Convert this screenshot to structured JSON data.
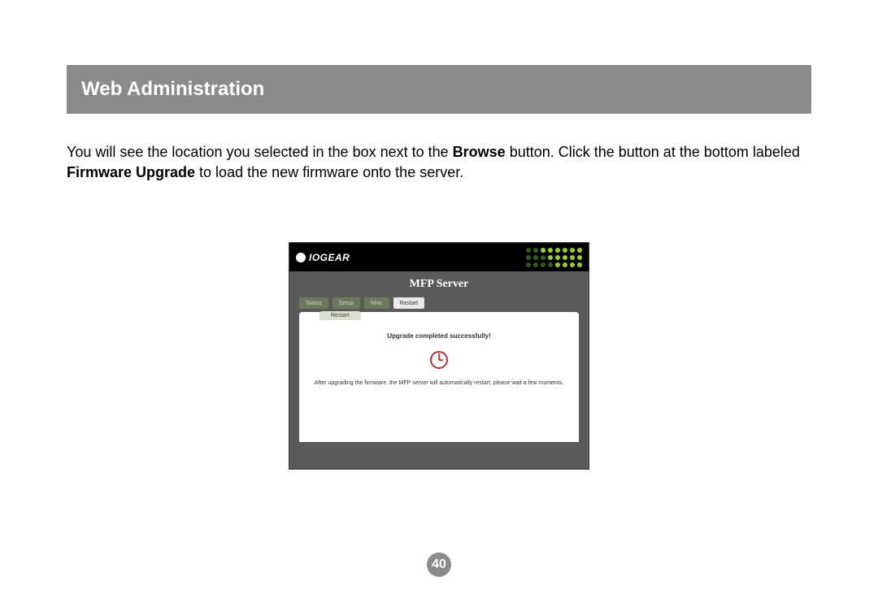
{
  "header": {
    "title": "Web Administration"
  },
  "instruction": {
    "part1": "You will see the location you selected in the box next to the ",
    "bold1": "Browse",
    "part2": " button.  Click the button at the bottom labeled ",
    "bold2": "Firmware Upgrade",
    "part3": " to load the new firmware onto the server."
  },
  "screenshot": {
    "logo": "IOGEAR",
    "title": "MFP Server",
    "tabs": [
      {
        "label": "Status"
      },
      {
        "label": "Setup"
      },
      {
        "label": "Misc"
      },
      {
        "label": "Restart"
      }
    ],
    "subtab": "Restart",
    "success": "Upgrade completed successfully!",
    "hint": "After upgrading the firmware, the MFP server will automatically restart, please wait a few moments."
  },
  "pageNumber": "40"
}
